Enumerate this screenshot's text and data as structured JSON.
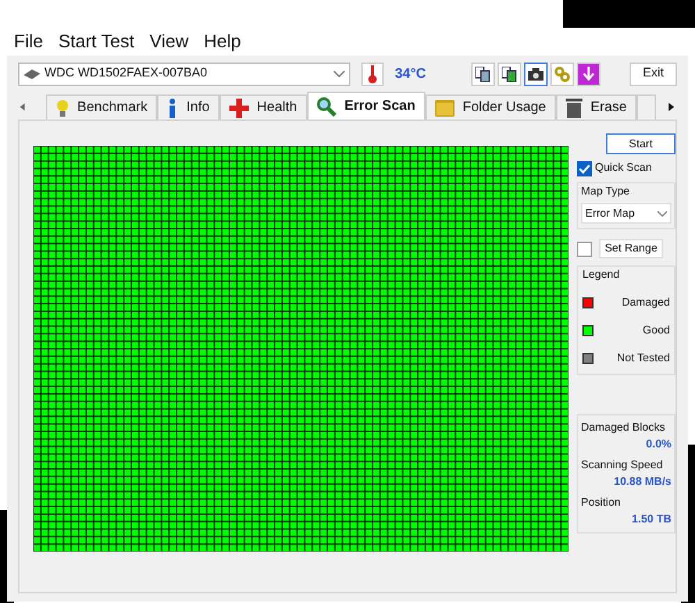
{
  "menu": [
    "File",
    "Start Test",
    "View",
    "Help"
  ],
  "drive": {
    "value": "WDC WD1502FAEX-007BA0"
  },
  "temperature": "34°C",
  "exit_button": "Exit",
  "tabs": [
    {
      "label": "Benchmark",
      "selected": false
    },
    {
      "label": "Info",
      "selected": false
    },
    {
      "label": "Health",
      "selected": false
    },
    {
      "label": "Error Scan",
      "selected": true
    },
    {
      "label": "Folder Usage",
      "selected": false
    },
    {
      "label": "Erase",
      "selected": false
    }
  ],
  "scan": {
    "start_button": "Start",
    "quick_scan": {
      "label": "Quick Scan",
      "checked": true
    },
    "map_type": {
      "title": "Map Type",
      "value": "Error Map"
    },
    "set_range": {
      "label": "Set Range",
      "checked": false
    },
    "legend": {
      "title": "Legend",
      "items": [
        {
          "label": "Damaged",
          "color": "#ff0000"
        },
        {
          "label": "Good",
          "color": "#00ff00"
        },
        {
          "label": "Not Tested",
          "color": "#808080"
        }
      ]
    },
    "stats": [
      {
        "label": "Damaged Blocks",
        "value": "0.0%"
      },
      {
        "label": "Scanning Speed",
        "value": "10.88 MB/s"
      },
      {
        "label": "Position",
        "value": "1.50 TB"
      }
    ]
  }
}
